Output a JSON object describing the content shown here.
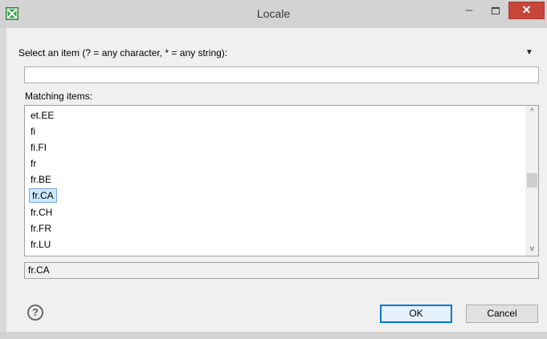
{
  "window": {
    "title": "Locale"
  },
  "icons": {
    "app": "eclipse-dialog-icon",
    "minimize": "minimize-icon",
    "maximize": "maximize-icon",
    "close": "close-icon",
    "menu": "dropdown-triangle-icon",
    "help": "help-icon"
  },
  "colors": {
    "close_button": "#c7463b",
    "selection_highlight": "#cce8ff",
    "default_button_border": "#0078d7"
  },
  "dialog": {
    "prompt": "Select an item (? = any character, * = any string):",
    "filter_value": "",
    "matching_label": "Matching items:",
    "items": [
      "et.EE",
      "fi",
      "fi.FI",
      "fr",
      "fr.BE",
      "fr.CA",
      "fr.CH",
      "fr.FR",
      "fr.LU"
    ],
    "selected_index": 5,
    "selection_text": "fr.CA"
  },
  "buttons": {
    "help_glyph": "?",
    "ok": "OK",
    "cancel": "Cancel",
    "minimize_glyph": "–",
    "close_glyph": "✕",
    "menu_glyph": "▼",
    "scroll_up_glyph": "^",
    "scroll_down_glyph": "v"
  }
}
